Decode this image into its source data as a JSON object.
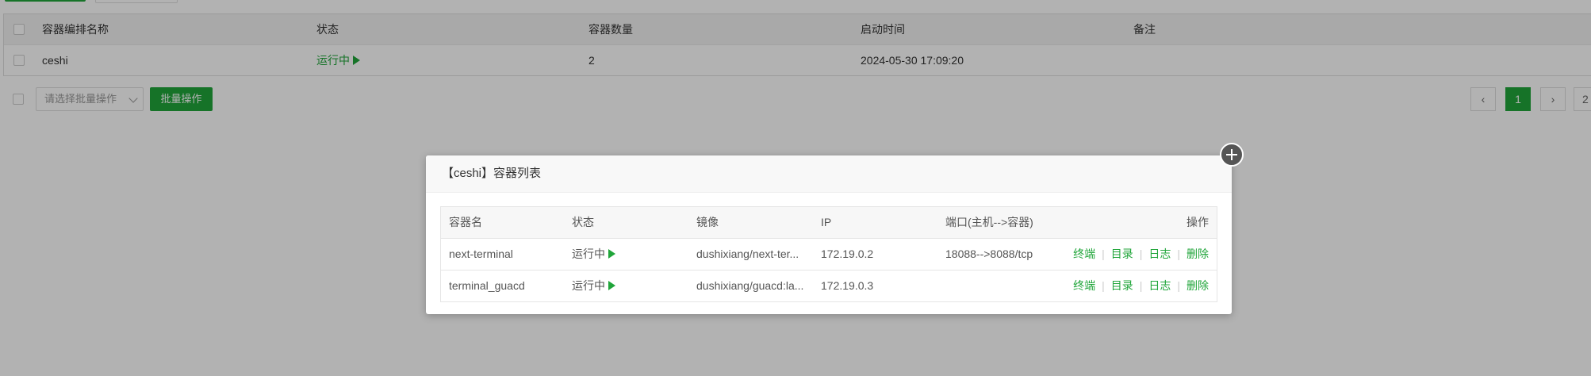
{
  "main_table": {
    "headers": [
      "容器编排名称",
      "状态",
      "容器数量",
      "启动时间",
      "备注"
    ],
    "rows": [
      {
        "name": "ceshi",
        "status": "运行中",
        "count": "2",
        "start_time": "2024-05-30 17:09:20",
        "remark": ""
      }
    ]
  },
  "batch": {
    "select_placeholder": "请选择批量操作",
    "button_label": "批量操作"
  },
  "pagination": {
    "prev": "‹",
    "current": "1",
    "next": "›",
    "partial": "2"
  },
  "modal": {
    "title": "【ceshi】容器列表",
    "headers": [
      "容器名",
      "状态",
      "镜像",
      "IP",
      "端口(主机-->容器)",
      "操作"
    ],
    "rows": [
      {
        "name": "next-terminal",
        "status": "运行中",
        "image": "dushixiang/next-ter...",
        "ip": "172.19.0.2",
        "ports": "18088-->8088/tcp"
      },
      {
        "name": "terminal_guacd",
        "status": "运行中",
        "image": "dushixiang/guacd:la...",
        "ip": "172.19.0.3",
        "ports": ""
      }
    ],
    "actions": [
      "终端",
      "目录",
      "日志",
      "删除"
    ]
  },
  "colors": {
    "accent": "#20a53a"
  }
}
